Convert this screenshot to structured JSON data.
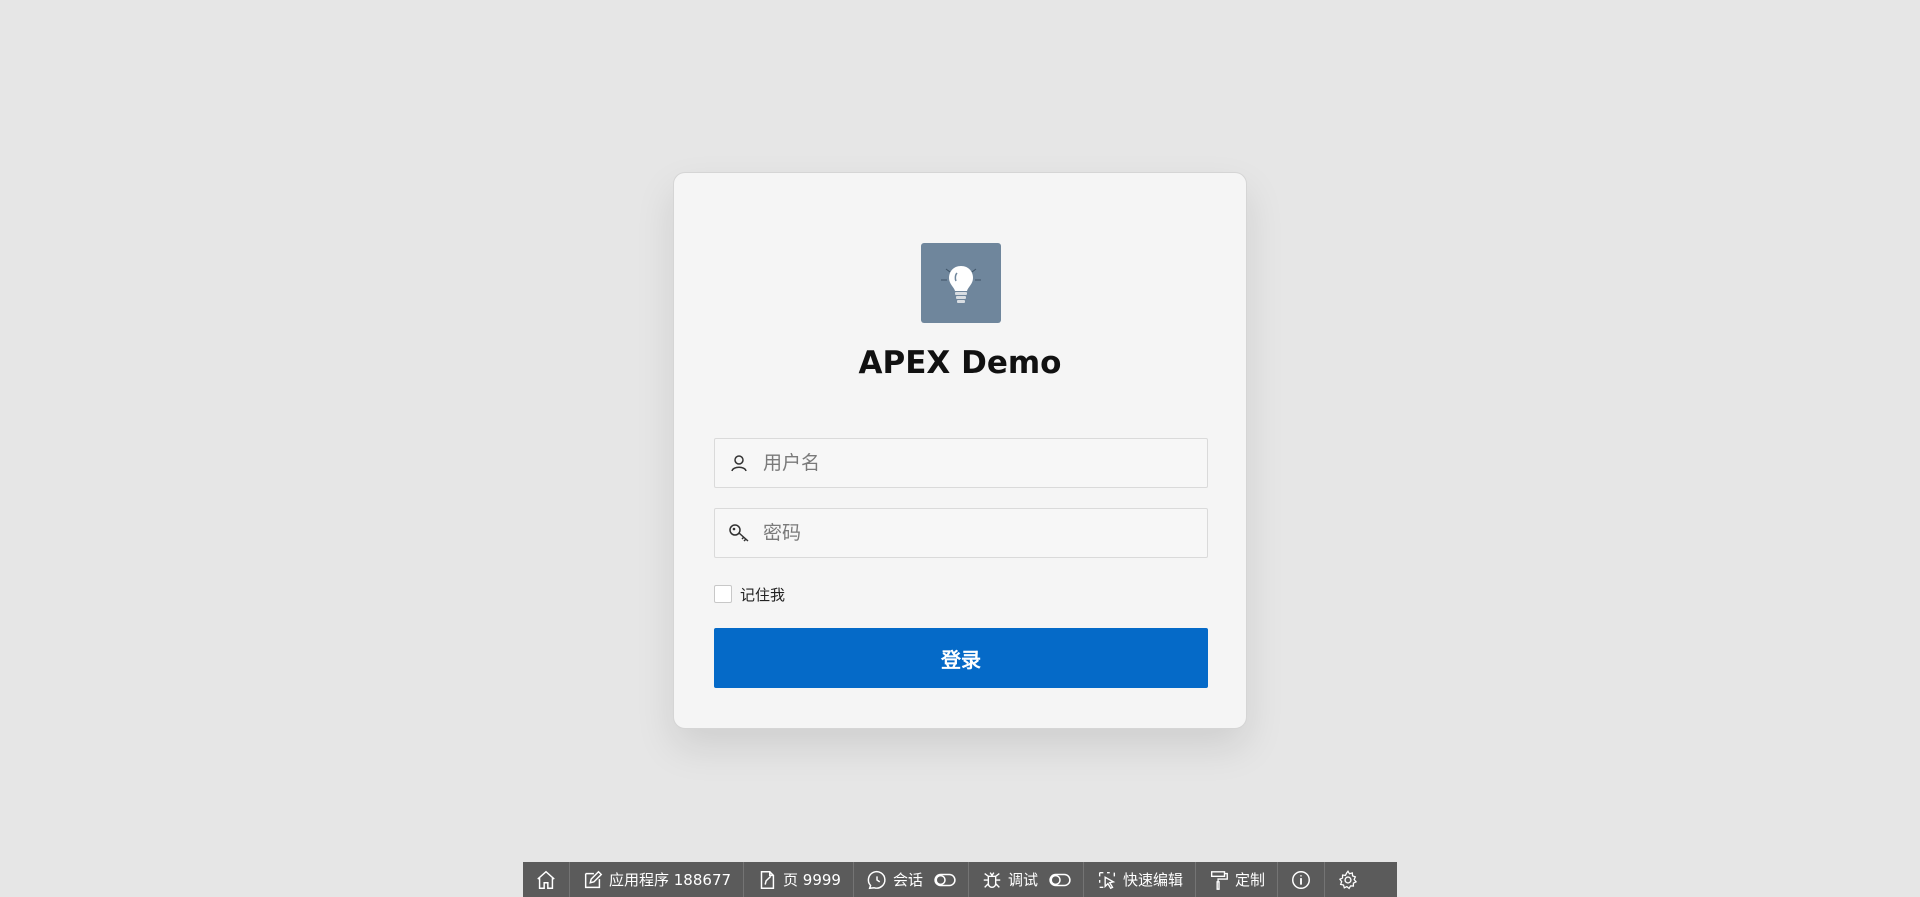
{
  "app": {
    "title": "APEX Demo",
    "icon": "lightbulb-icon",
    "icon_bg": "#6f869c"
  },
  "login_form": {
    "username_placeholder": "用户名",
    "password_placeholder": "密码",
    "remember_label": "记住我",
    "remember_checked": false,
    "submit_label": "登录",
    "submit_color": "#056ac8"
  },
  "dev_toolbar": {
    "home_icon": "home-icon",
    "application_label": "应用程序 188677",
    "page_label": "页 9999",
    "session_label": "会话",
    "debug_label": "调试",
    "quick_edit_label": "快速编辑",
    "customize_label": "定制",
    "info_icon": "info-icon",
    "settings_icon": "gear-icon"
  }
}
